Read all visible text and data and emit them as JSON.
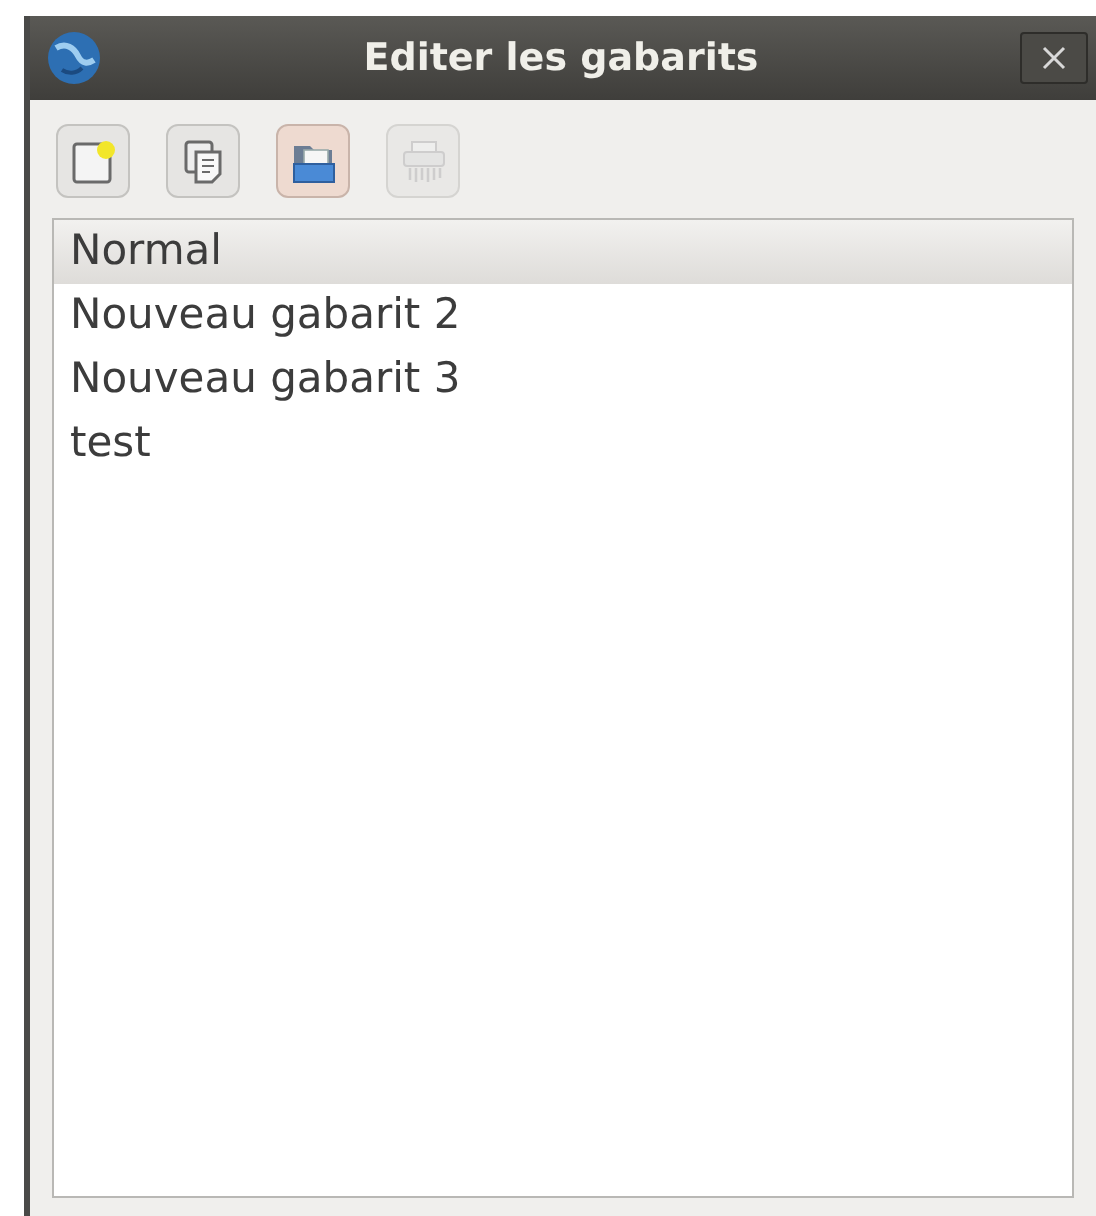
{
  "window": {
    "title": "Editer les gabarits"
  },
  "toolbar": [
    {
      "kind": "new",
      "disabled": false,
      "highlighted": false
    },
    {
      "kind": "duplicate",
      "disabled": false,
      "highlighted": false
    },
    {
      "kind": "open",
      "disabled": false,
      "highlighted": true
    },
    {
      "kind": "delete",
      "disabled": true,
      "highlighted": false
    }
  ],
  "templates": [
    {
      "label": "Normal",
      "selected": true
    },
    {
      "label": "Nouveau gabarit 2",
      "selected": false
    },
    {
      "label": "Nouveau gabarit 3",
      "selected": false
    },
    {
      "label": "test",
      "selected": false
    }
  ]
}
